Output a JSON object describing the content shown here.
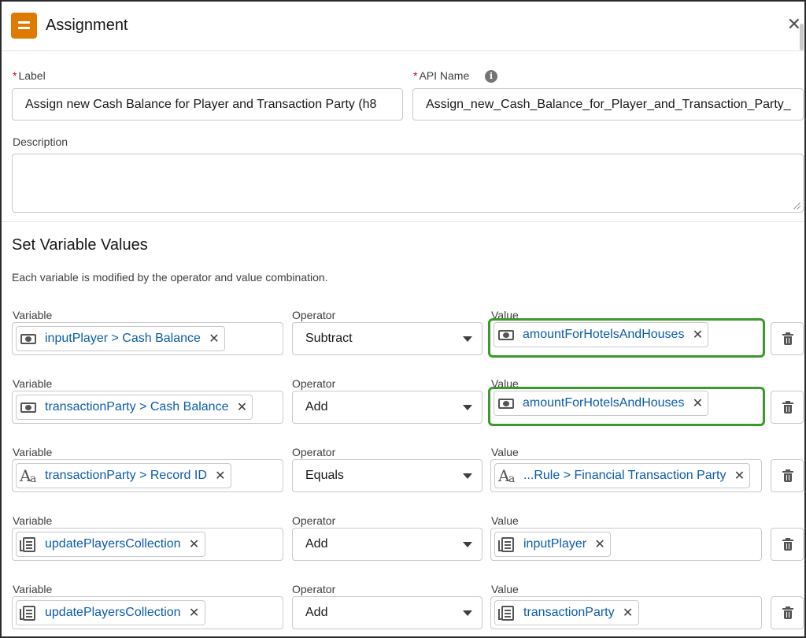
{
  "header": {
    "title": "Assignment",
    "close_symbol": "✕"
  },
  "fields": {
    "label": {
      "required_mark": "*",
      "label": "Label",
      "value": "Assign new Cash Balance for Player and Transaction Party (h8"
    },
    "api_name": {
      "required_mark": "*",
      "label": "API Name",
      "info_symbol": "i",
      "value": "Assign_new_Cash_Balance_for_Player_and_Transaction_Party_"
    },
    "description": {
      "label": "Description",
      "value": ""
    }
  },
  "section": {
    "title": "Set Variable Values",
    "description": "Each variable is modified by the operator and value combination."
  },
  "column_labels": {
    "variable": "Variable",
    "operator": "Operator",
    "value": "Value"
  },
  "rows": [
    {
      "variable": {
        "icon": "currency-icon",
        "text": "inputPlayer > Cash Balance"
      },
      "operator": "Subtract",
      "value": {
        "icon": "currency-icon",
        "text": "amountForHotelsAndHouses",
        "highlighted": true
      }
    },
    {
      "variable": {
        "icon": "currency-icon",
        "text": "transactionParty > Cash Balance"
      },
      "operator": "Add",
      "value": {
        "icon": "currency-icon",
        "text": "amountForHotelsAndHouses",
        "highlighted": true
      }
    },
    {
      "variable": {
        "icon": "text-type-icon",
        "text": "transactionParty > Record ID"
      },
      "operator": "Equals",
      "value": {
        "icon": "text-type-icon",
        "text": "...Rule > Financial Transaction Party",
        "highlighted": false
      }
    },
    {
      "variable": {
        "icon": "collection-icon",
        "text": "updatePlayersCollection"
      },
      "operator": "Add",
      "value": {
        "icon": "record-icon",
        "text": "inputPlayer",
        "highlighted": false
      }
    },
    {
      "variable": {
        "icon": "collection-icon",
        "text": "updatePlayersCollection"
      },
      "operator": "Add",
      "value": {
        "icon": "record-icon",
        "text": "transactionParty",
        "highlighted": false
      }
    }
  ],
  "pill_remove_symbol": "✕",
  "colors": {
    "accent_highlight": "#3a9a2a",
    "app_icon": "#dd7a01",
    "link_text": "#0b5cab",
    "required": "#ba0517"
  }
}
